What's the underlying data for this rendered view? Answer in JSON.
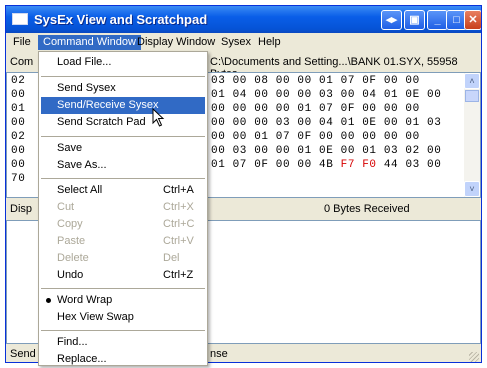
{
  "window": {
    "title": "SysEx View and Scratchpad"
  },
  "menubar": {
    "items": [
      "File",
      "Command Window",
      "Display Window",
      "Sysex",
      "Help"
    ],
    "active": "Command Window"
  },
  "command_pane": {
    "label_partial": "Com"
  },
  "display_pane": {
    "header": "C:\\Documents and Setting...\\BANK 01.SYX,  55958 Bytes",
    "hex_rows": [
      "03 00 08 00 00 01 07 0F 00 00",
      "01 04 00 00 00 03 00 04 01 0E 00",
      "00 00 00 00 01 07 0F 00 00 00",
      "00 00 00 03 00 04 01 0E 00 01 03",
      "00 00 01 07 0F 00 00 00 00 00",
      "00 03 00 00 01 0E 00 01 03 02 00",
      "01 07 0F 00 00 4B"
    ],
    "last_row_red": "F7 F0",
    "last_row_tail": "44 03 00",
    "left_col": [
      "02",
      "00",
      "01",
      "00",
      "02",
      "00",
      "00",
      "70"
    ]
  },
  "status": {
    "left_partial": "Disp",
    "bytes_received": "0 Bytes Received"
  },
  "bottom": {
    "send_partial": "Send",
    "response_partial": "nse"
  },
  "command_menu": {
    "items": [
      {
        "label": "Load File..."
      },
      {
        "label": "Send Sysex"
      },
      {
        "label": "Send/Receive Sysex"
      },
      {
        "label": "Send Scratch Pad"
      },
      {
        "label": "Save"
      },
      {
        "label": "Save As..."
      },
      {
        "label": "Select All",
        "accel": "Ctrl+A"
      },
      {
        "label": "Cut",
        "accel": "Ctrl+X"
      },
      {
        "label": "Copy",
        "accel": "Ctrl+C"
      },
      {
        "label": "Paste",
        "accel": "Ctrl+V"
      },
      {
        "label": "Delete",
        "accel": "Del"
      },
      {
        "label": "Undo",
        "accel": "Ctrl+Z"
      },
      {
        "label": "Word Wrap"
      },
      {
        "label": "Hex View Swap"
      },
      {
        "label": "Find..."
      },
      {
        "label": "Replace..."
      }
    ]
  },
  "colors": {
    "titlebar": "#0a5ee8",
    "highlight": "#316ac5",
    "hex_red": "#d60000"
  }
}
